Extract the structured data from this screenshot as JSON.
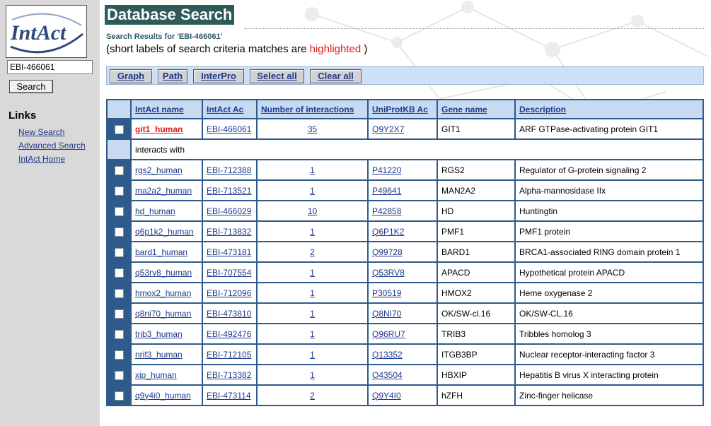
{
  "sidebar": {
    "logo_text": "IntAct",
    "search_value": "EBI-466061",
    "search_button": "Search",
    "links_heading": "Links",
    "links": [
      "New Search",
      "Advanced Search",
      "IntAct Home"
    ]
  },
  "header": {
    "title": "Database Search",
    "results_label": "Search Results for 'EBI-466061'",
    "hint_prefix": "(short labels of search criteria matches are ",
    "hint_highlight": "highlighted",
    "hint_suffix": " )"
  },
  "toolbar": {
    "buttons": [
      "Graph",
      "Path",
      "InterPro",
      "Select all",
      "Clear all"
    ]
  },
  "table": {
    "columns": [
      "IntAct name",
      "IntAct Ac",
      "Number of interactions",
      "UniProtKB Ac",
      "Gene name",
      "Description"
    ],
    "query_row": {
      "name": "git1_human",
      "ac": "EBI-466061",
      "interactions": "35",
      "uniprot": "Q9Y2X7",
      "gene": "GIT1",
      "description": "ARF GTPase-activating protein GIT1"
    },
    "interacts_label": "interacts with",
    "rows": [
      {
        "name": "rgs2_human",
        "ac": "EBI-712388",
        "interactions": "1",
        "uniprot": "P41220",
        "gene": "RGS2",
        "description": "Regulator of G-protein signaling 2"
      },
      {
        "name": "ma2a2_human",
        "ac": "EBI-713521",
        "interactions": "1",
        "uniprot": "P49641",
        "gene": "MAN2A2",
        "description": "Alpha-mannosidase IIx"
      },
      {
        "name": "hd_human",
        "ac": "EBI-466029",
        "interactions": "10",
        "uniprot": "P42858",
        "gene": "HD",
        "description": "Huntingtin"
      },
      {
        "name": "q6p1k2_human",
        "ac": "EBI-713832",
        "interactions": "1",
        "uniprot": "Q6P1K2",
        "gene": "PMF1",
        "description": "PMF1 protein"
      },
      {
        "name": "bard1_human",
        "ac": "EBI-473181",
        "interactions": "2",
        "uniprot": "Q99728",
        "gene": "BARD1",
        "description": "BRCA1-associated RING domain protein 1"
      },
      {
        "name": "q53rv8_human",
        "ac": "EBI-707554",
        "interactions": "1",
        "uniprot": "Q53RV8",
        "gene": "APACD",
        "description": "Hypothetical protein APACD"
      },
      {
        "name": "hmox2_human",
        "ac": "EBI-712096",
        "interactions": "1",
        "uniprot": "P30519",
        "gene": "HMOX2",
        "description": "Heme oxygenase 2"
      },
      {
        "name": "q8ni70_human",
        "ac": "EBI-473810",
        "interactions": "1",
        "uniprot": "Q8NI70",
        "gene": "OK/SW-cl.16",
        "description": "OK/SW-CL.16"
      },
      {
        "name": "trib3_human",
        "ac": "EBI-492476",
        "interactions": "1",
        "uniprot": "Q96RU7",
        "gene": "TRIB3",
        "description": "Tribbles homolog 3"
      },
      {
        "name": "nrif3_human",
        "ac": "EBI-712105",
        "interactions": "1",
        "uniprot": "Q13352",
        "gene": "ITGB3BP",
        "description": "Nuclear receptor-interacting factor 3"
      },
      {
        "name": "xip_human",
        "ac": "EBI-713382",
        "interactions": "1",
        "uniprot": "O43504",
        "gene": "HBXIP",
        "description": "Hepatitis B virus X interacting protein"
      },
      {
        "name": "q9y4i0_human",
        "ac": "EBI-473114",
        "interactions": "2",
        "uniprot": "Q9Y4I0",
        "gene": "hZFH",
        "description": "Zinc-finger helicase"
      }
    ]
  },
  "colors": {
    "sidebar_bg": "#d9d9d9",
    "title_bg": "#2e5a5a",
    "table_border": "#2e5a8c",
    "header_bg": "#c7daf2",
    "toolbar_bg": "#cde0f7",
    "link": "#1e3a8c",
    "highlight": "#e0191b"
  }
}
